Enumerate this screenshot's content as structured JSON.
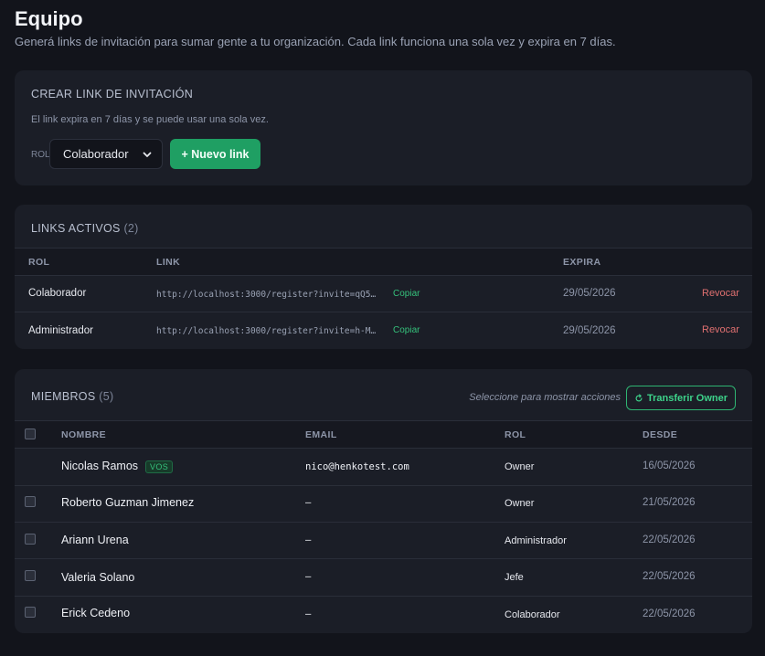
{
  "header": {
    "title": "Equipo",
    "subtitle": "Generá links de invitación para sumar gente a tu organización. Cada link funciona una sola vez y expira en 7 días."
  },
  "create": {
    "title": "CREAR LINK DE INVITACIÓN",
    "help": "El link expira en 7 días y se puede usar una sola vez.",
    "role_label": "ROL",
    "selected_role": "Colaborador",
    "new_link_label": "+ Nuevo link"
  },
  "links": {
    "title": "LINKS ACTIVOS",
    "count": "(2)",
    "headers": {
      "role": "ROL",
      "link": "LINK",
      "expires": "EXPIRA"
    },
    "rows": [
      {
        "role": "Colaborador",
        "link": "http://localhost:3000/register?invite=qQ5…",
        "copy": "Copiar",
        "expires": "29/05/2026",
        "revoke": "Revocar"
      },
      {
        "role": "Administrador",
        "link": "http://localhost:3000/register?invite=h-M…",
        "copy": "Copiar",
        "expires": "29/05/2026",
        "revoke": "Revocar"
      }
    ]
  },
  "members": {
    "title": "MIEMBROS",
    "count": "(5)",
    "hint": "Seleccione para mostrar acciones",
    "transfer_label": "Transferir Owner",
    "headers": {
      "name": "NOMBRE",
      "email": "EMAIL",
      "role": "ROL",
      "since": "DESDE"
    },
    "rows": [
      {
        "name": "Nicolas Ramos",
        "badge": "VOS",
        "email": "nico@henkotest.com",
        "role": "Owner",
        "since": "16/05/2026"
      },
      {
        "name": "Roberto Guzman Jimenez",
        "email": "–",
        "role": "Owner",
        "since": "21/05/2026"
      },
      {
        "name": "Ariann Urena",
        "email": "–",
        "role": "Administrador",
        "since": "22/05/2026"
      },
      {
        "name": "Valeria Solano",
        "email": "–",
        "role": "Jefe",
        "since": "22/05/2026"
      },
      {
        "name": "Erick Cedeno",
        "email": "–",
        "role": "Colaborador",
        "since": "22/05/2026"
      }
    ]
  }
}
